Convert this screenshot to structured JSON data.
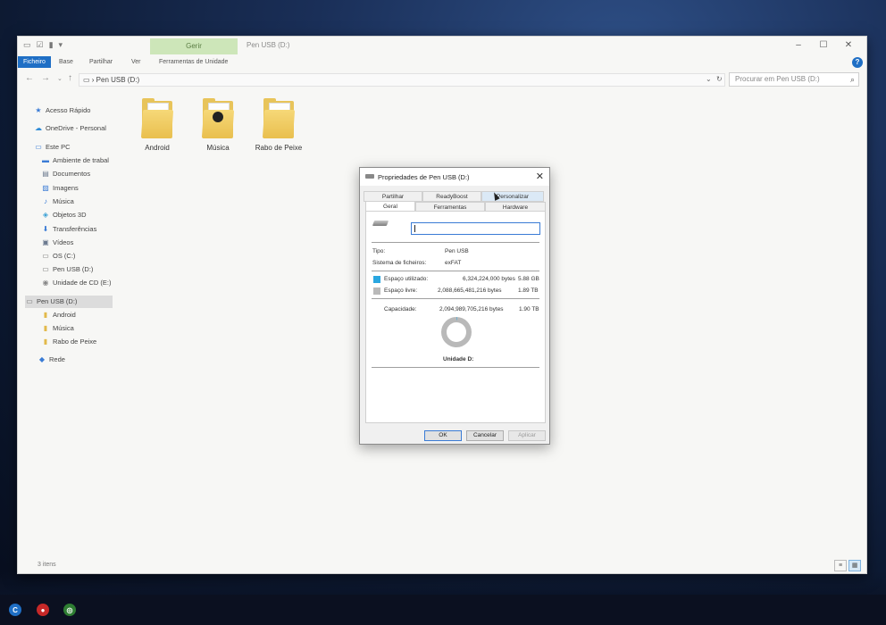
{
  "explorer": {
    "window_title": "Pen USB (D:)",
    "context_tab": "Gerir",
    "ribbon_tabs": [
      "Ficheiro",
      "Base",
      "Partilhar",
      "Ver",
      "Ferramentas de Unidade"
    ],
    "address_path": "Pen USB (D:)",
    "search_placeholder": "Procurar em Pen USB (D:)",
    "status_text": "3 itens"
  },
  "sidebar": {
    "items": [
      {
        "label": "Acesso Rápido",
        "icon": "star-icon"
      },
      {
        "label": "OneDrive - Personal",
        "icon": "cloud-icon"
      },
      {
        "label": "Este PC",
        "icon": "computer-icon"
      },
      {
        "label": "Ambiente de trabal",
        "icon": "desktop-icon"
      },
      {
        "label": "Documentos",
        "icon": "documents-icon"
      },
      {
        "label": "Imagens",
        "icon": "pictures-icon"
      },
      {
        "label": "Música",
        "icon": "music-icon"
      },
      {
        "label": "Objetos 3D",
        "icon": "cube-icon"
      },
      {
        "label": "Transferências",
        "icon": "download-icon"
      },
      {
        "label": "Vídeos",
        "icon": "video-icon"
      },
      {
        "label": "OS (C:)",
        "icon": "drive-icon"
      },
      {
        "label": "Pen USB (D:)",
        "icon": "usb-drive-icon"
      },
      {
        "label": "Unidade de CD (E:)",
        "icon": "cd-drive-icon"
      },
      {
        "label": "Pen USB (D:)",
        "icon": "usb-drive-icon"
      },
      {
        "label": "Android",
        "icon": "folder-icon"
      },
      {
        "label": "Música",
        "icon": "folder-icon"
      },
      {
        "label": "Rabo de Peixe",
        "icon": "folder-icon"
      },
      {
        "label": "Rede",
        "icon": "network-icon"
      }
    ]
  },
  "folders": [
    {
      "label": "Android"
    },
    {
      "label": "Música"
    },
    {
      "label": "Rabo de Peixe"
    }
  ],
  "dialog": {
    "title": "Propriedades de Pen USB (D:)",
    "tabs_row1": [
      "Partilhar",
      "ReadyBoost",
      "Personalizar"
    ],
    "tabs_row2": [
      "Geral",
      "Ferramentas",
      "Hardware"
    ],
    "type_label": "Tipo:",
    "type_value": "Pen USB",
    "fs_label": "Sistema de ficheiros:",
    "fs_value": "exFAT",
    "used_label": "Espaço utilizado:",
    "used_bytes": "6,324,224,000 bytes",
    "used_size": "5.88 GB",
    "free_label": "Espaço livre:",
    "free_bytes": "2,088,665,481,216 bytes",
    "free_size": "1.89 TB",
    "capacity_label": "Capacidade:",
    "capacity_bytes": "2,094,989,705,216 bytes",
    "capacity_size": "1.90 TB",
    "drive_label": "Unidade D:",
    "ok": "OK",
    "cancel": "Cancelar",
    "apply": "Aplicar",
    "used_fraction": 0.003,
    "used_color": "#2aa7e0",
    "free_color": "#b9b9b9"
  },
  "taskbar": {
    "icons": [
      "cortana-icon",
      "red-app-icon",
      "green-app-icon"
    ]
  }
}
